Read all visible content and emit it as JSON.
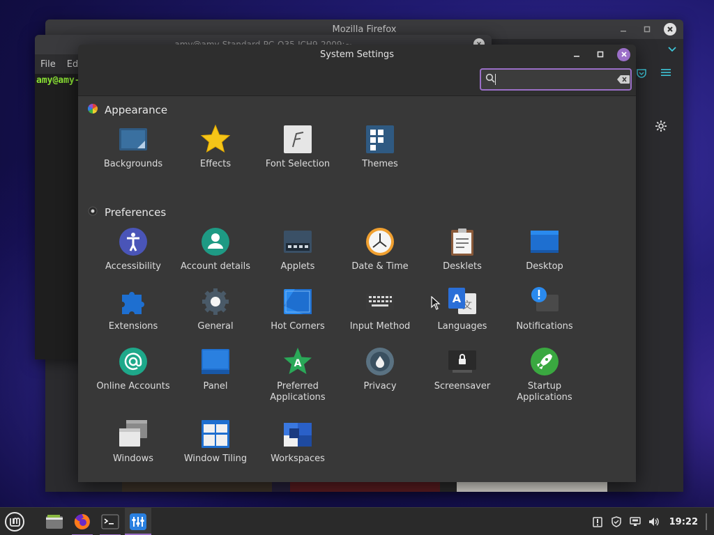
{
  "firefox": {
    "title": "Mozilla Firefox"
  },
  "terminal": {
    "title": "amy@amy-Standard-PC-Q35-ICH9-2009:~",
    "menu": [
      "File",
      "Ed"
    ],
    "prompt": "amy@amy-"
  },
  "settings": {
    "title": "System Settings",
    "search": {
      "value": "",
      "placeholder": ""
    },
    "sections": [
      {
        "title": "Appearance",
        "items": [
          {
            "label": "Backgrounds",
            "icon": "backgrounds-icon"
          },
          {
            "label": "Effects",
            "icon": "effects-icon"
          },
          {
            "label": "Font Selection",
            "icon": "font-selection-icon"
          },
          {
            "label": "Themes",
            "icon": "themes-icon"
          }
        ]
      },
      {
        "title": "Preferences",
        "items": [
          {
            "label": "Accessibility",
            "icon": "accessibility-icon"
          },
          {
            "label": "Account details",
            "icon": "account-details-icon"
          },
          {
            "label": "Applets",
            "icon": "applets-icon"
          },
          {
            "label": "Date & Time",
            "icon": "date-time-icon"
          },
          {
            "label": "Desklets",
            "icon": "desklets-icon"
          },
          {
            "label": "Desktop",
            "icon": "desktop-icon"
          },
          {
            "label": "Extensions",
            "icon": "extensions-icon"
          },
          {
            "label": "General",
            "icon": "general-icon"
          },
          {
            "label": "Hot Corners",
            "icon": "hot-corners-icon"
          },
          {
            "label": "Input Method",
            "icon": "input-method-icon"
          },
          {
            "label": "Languages",
            "icon": "languages-icon"
          },
          {
            "label": "Notifications",
            "icon": "notifications-icon"
          },
          {
            "label": "Online Accounts",
            "icon": "online-accounts-icon"
          },
          {
            "label": "Panel",
            "icon": "panel-icon"
          },
          {
            "label": "Preferred Applications",
            "icon": "preferred-applications-icon"
          },
          {
            "label": "Privacy",
            "icon": "privacy-icon"
          },
          {
            "label": "Screensaver",
            "icon": "screensaver-icon"
          },
          {
            "label": "Startup Applications",
            "icon": "startup-applications-icon"
          },
          {
            "label": "Windows",
            "icon": "windows-icon"
          },
          {
            "label": "Window Tiling",
            "icon": "window-tiling-icon"
          },
          {
            "label": "Workspaces",
            "icon": "workspaces-icon"
          }
        ]
      }
    ]
  },
  "taskbar": {
    "launchers": [
      "menu-icon",
      "files-icon",
      "firefox-icon",
      "terminal-icon",
      "system-settings-icon"
    ],
    "tray": [
      "notifications-tray-icon",
      "update-manager-icon",
      "network-icon",
      "volume-icon"
    ],
    "clock": "19:22"
  },
  "colors": {
    "accent": "#9b6fc8",
    "window_bg": "#383838",
    "titlebar_bg": "#2e2e2e"
  }
}
